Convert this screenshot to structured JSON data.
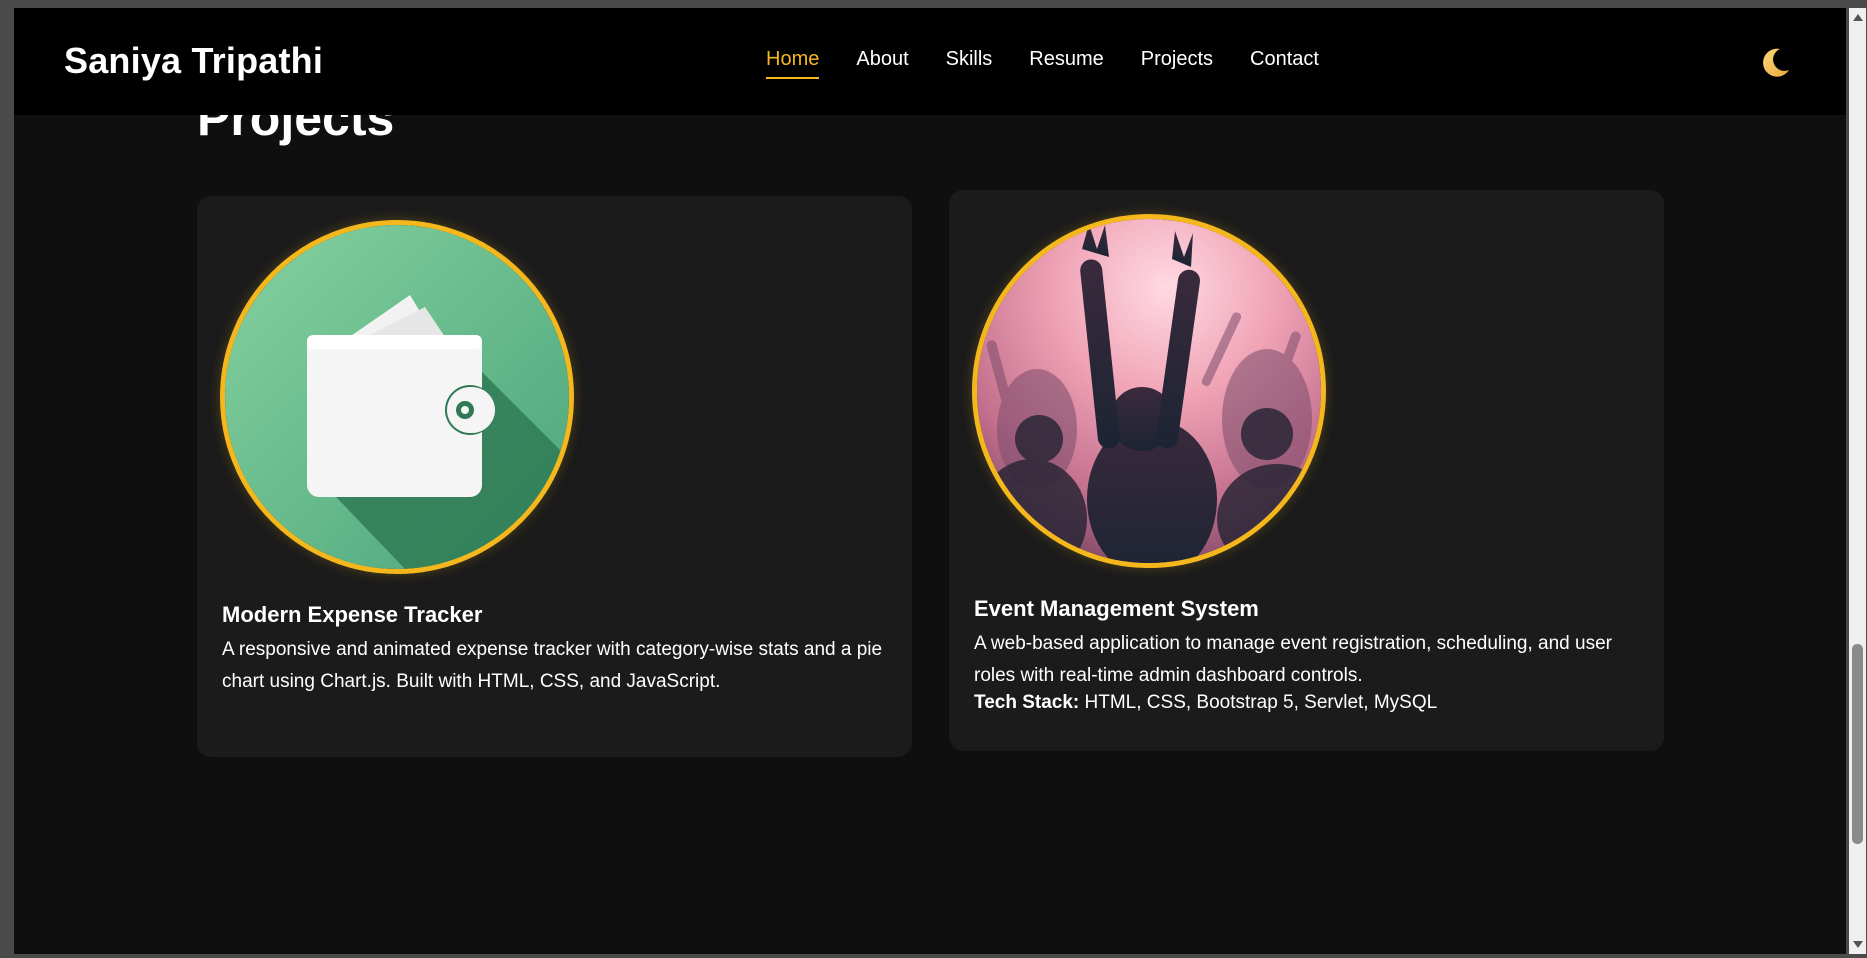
{
  "nav": {
    "brand": "Saniya Tripathi",
    "links": [
      {
        "label": "Home",
        "active": true
      },
      {
        "label": "About",
        "active": false
      },
      {
        "label": "Skills",
        "active": false
      },
      {
        "label": "Resume",
        "active": false
      },
      {
        "label": "Projects",
        "active": false
      },
      {
        "label": "Contact",
        "active": false
      }
    ],
    "theme_icon": "crescent-moon-icon"
  },
  "section": {
    "title": "Projects"
  },
  "projects": [
    {
      "title": "Modern Expense Tracker",
      "description": "A responsive and animated expense tracker with category-wise stats and a pie chart using Chart.js. Built with HTML, CSS, and JavaScript.",
      "image": "wallet-icon"
    },
    {
      "title": "Event Management System",
      "description": "A web-based application to manage event registration, scheduling, and user roles with real-time admin dashboard controls.",
      "tech_label": "Tech Stack:",
      "tech_value": "HTML, CSS, Bootstrap 5, Servlet, MySQL",
      "image": "concert-crowd-photo"
    }
  ],
  "colors": {
    "accent": "#f5b81c",
    "background": "#0f0f0f",
    "card": "#1b1b1b",
    "navbar": "#000000"
  }
}
